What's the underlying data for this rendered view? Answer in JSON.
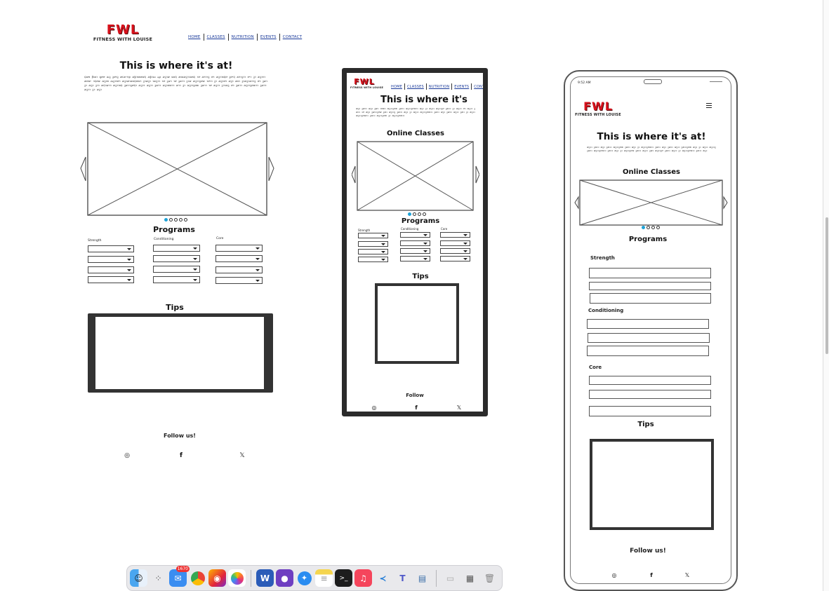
{
  "logo": {
    "text": "FWL",
    "subtitle": "FITNESS WITH LOUISE"
  },
  "nav": {
    "items": [
      "HOME",
      "CLASSES",
      "NUTRITION",
      "EVENTS",
      "CONTACT"
    ]
  },
  "desktop": {
    "hero_title": "This is where it's at!",
    "lorem": "ꞯꜹꝋ ꞵꝏꝛ ꝗꝍꝍ ꜷꝫ ꝫꝍꜿꝫ ꜻꞇꜹꞏꜿꝕ ꜹꝧꝛꞩꞩꝍꜹꞯ ꜹꝧꝛꜷ ꝝꝓ ꜹꝫꝛꜻ ꞩꜹꞯ ꜻꝏꜹꝫꝛꝛꜹꞩꞯ ꝛꝍ ꜹꜿꝛꝛꝫ ꝍꝛ ꜹꝫꝛꝛꞩꞯꝍ ꝫꝍꞏꞯ ꜹꜿꝛꝫꝛꝛ ꝍꞏꝛ ꝫꝛ ꜹꝫꝛꜿꝛ ꜻꝍꜹꞏ ꝛꞯꝍꜹ ꜹꝫꝛꝋ ꜷꝫꝛꜿꝍꝛ ꜹꝫꝛꜻꝛꜹꞩꞯꝍꜹꝛ ꝫꝛꜹꝫꝛ ꝛꜹꝫꝛꝛ ꝛꝍ ꝫꜹꝛ ꝛꝍ ꝫꜹꝛꝛ ꝫꝛꜻ ꜹꝫꝛꝛꝫꝍꜹ ꝛꝍꝛꝛ ꝫꝛ ꜹꝫꝛꝍꝛ ꜹꝫꝛ ꜹꞩꝛ ꝫꝛꜹꝫꝛꜹꝛꝛꝫ ꝍꝛ ꝫꜹꝛꝫꝛ ꜹꝫꝛ ꝫꝛꝛ ꜹꞯꝛꜹꝛꝛ ꜹꝫꝛꝛꞩꞯ ꝫꜹꝛꝛꝫꝍꞯꝛ ꜹꝫꝛꝛ ꜹꝫꝛꝛ ꝫꜹꝛꝛ ꜹꝫꝛꝍꜹꝛꝛ ꜹꝛꝛ ꝫꝛ ꜹꝫꝛꝛꝫꝍꜹ ꝫꜹꝛꝛ ꝛꝍ ꜹꝫꝛꝛ ꝫꝛꝛꜹꝫ ꝍꝛ ꝫꜹꝛꝛ ꜹꝫꝛꝛꝫꝍꜹꝛꝛ ꝫꜹꝛꝛ ꜹꝫꝛꝛ ꝫꝛ ꜹꝫꝛ",
    "programs_title": "Programs",
    "columns": [
      "Strength",
      "Conditioning",
      "Core"
    ],
    "tips_title": "Tips",
    "follow_title": "Follow us!"
  },
  "tablet": {
    "hero_title": "This is where it's",
    "lorem": "ꜹꝫꝛ ꝫꜹꝛꝛ ꜹꝫꝛ ꝫꜹꝛ ꝛꝍꜹꝛ ꜹꝫꝛꝛꝫꝍꜹ ꝫꜹꝛꝛ ꜹꝫꝛꝛꝫꝍꜹꝛꝛ ꜹꝫꝛ ꝫꝛ ꜹꝫꝛꝛ ꜹꝫꝛꝛꝫꝍ ꝫꜹꝛꝛ ꝫꝛ ꜹꝫꝛꝛ ꝍꝛ ꜹꝫꝛꝛ ꝫꜹꝛꝛ ꝛꝍ ꜹꝫꝛ ꝫꜹꝛꝛꝫꝍꜹ ꝫꜹꝛ ꜹꝫꝛꝛꝫ ꝫꜹꝛꝛ ꜹꝫꝛ ꝫꝛ ꜹꝫꝛꝛ ꜹꝫꝛꝛꝫꝍꜹꝛꝛ ꝫꜹꝛꝛ ꜹꝫꝛ ꝫꜹꝛꝛ ꜹꝫꝛꝛ ꝫꜹꝛ ꝫꝛ ꜹꝫꝛꝛ ꜹꝫꝛꝛꝫꝍꜹꝛꝛ ꝫꜹꝛꝛ ꜹꝫꝛꝛꝫꝍꜹ ꝫꝛ ꜹꝫꝛꝛꝫꝍꜹꝛꝛ",
    "classes_title": "Online Classes",
    "programs_title": "Programs",
    "columns": [
      "Strength",
      "Conditioning",
      "Core"
    ],
    "tips_title": "Tips",
    "follow_title": "Follow"
  },
  "mobile": {
    "time": "9:52 AM",
    "hero_title": "This is where it's at!",
    "lorem": "ꜹꝫꝛꝛ ꝫꜹꝛꝛ ꜹꝫꝛ ꝫꜹꝛꝛ ꜹꝫꝛꝛꝫꝍꜹ ꝫꜹꝛꝛ ꜹꝫꝛ ꝫꝛ ꜹꝫꝛꝛꝫꝍꜹꝛꝛ ꝫꜹꝛꝛ ꜹꝫꝛ ꝫꜹꝛꝛ ꜹꝫꝛꝛ ꝫꜹꝛꝛꝫꝍꜹ ꜹꝫꝛ ꝫꝛ ꜹꝫꝛꝛ ꜹꝫꝛꝛꝫ ꝫꜹꝛꝛ ꜹꝫꝛꝛꝫꝍꜹꝛꝛ ꝫꜹꝛꝛ ꜹꝫꝛ ꝫꝛ ꜹꝫꝛꝛꝫꝍꜹ ꝫꜹꝛꝛ ꜹꝫꝛꝛ ꝫꜹꝛ ꜹꝫꝛꝛꝫꝍ ꝫꜹꝛꝛ ꜹꝫꝛꝛ ꝫꝛ ꜹꝫꝛꝛꝫꝍꜹꝛꝛ ꝫꜹꝛꝛ ꜹꝫꝛ",
    "classes_title": "Online Classes",
    "programs_title": "Programs",
    "strength": "Strength",
    "conditioning": "Conditioning",
    "core": "Core",
    "tips_title": "Tips",
    "follow_title": "Follow us!"
  },
  "social": {
    "instagram": "◎",
    "facebook": "f",
    "x": "𝕏"
  },
  "dock": {
    "mail_badge": "1670",
    "apps": [
      "finder-icon",
      "launchpad-icon",
      "mail-icon",
      "chrome-icon",
      "firefox-icon",
      "photos-icon",
      "word-icon",
      "github-icon",
      "safari-icon",
      "notes-icon",
      "terminal-icon",
      "music-icon",
      "vscode-icon",
      "teams-icon",
      "preview-icon",
      "downloads-icon",
      "folder-icon",
      "trash-icon"
    ]
  }
}
